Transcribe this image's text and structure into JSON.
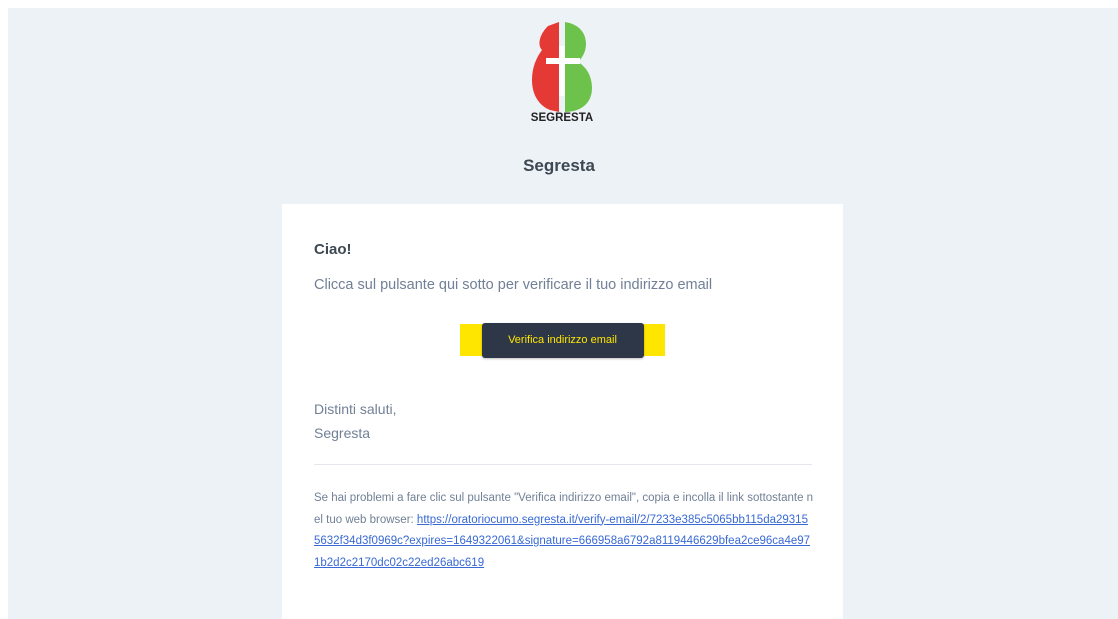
{
  "header": {
    "logo_text": "SEGRESTA",
    "brand_name": "Segresta"
  },
  "email": {
    "greeting": "Ciao!",
    "intro": "Clicca sul pulsante qui sotto per verificare il tuo indirizzo email",
    "button_label": "Verifica indirizzo email",
    "signoff_line1": "Distinti saluti,",
    "signoff_line2": "Segresta",
    "subcopy_text": "Se hai problemi a fare clic sul pulsante \"Verifica indirizzo email\", copia e incolla il link sottostante nel tuo web browser: ",
    "verify_url": "https://oratoriocumo.segresta.it/verify-email/2/7233e385c5065bb115da293155632f34d3f0969c?expires=1649322061&signature=666958a6792a8119446629bfea2ce96ca4e971b2d2c2170dc02c22ed26abc619"
  },
  "colors": {
    "background": "#edf2f7",
    "card": "#ffffff",
    "button": "#2d3748",
    "button_text": "#ffe600",
    "highlight": "#ffe600",
    "link": "#3869d4",
    "logo_red": "#e53935",
    "logo_green": "#6cc24a"
  }
}
